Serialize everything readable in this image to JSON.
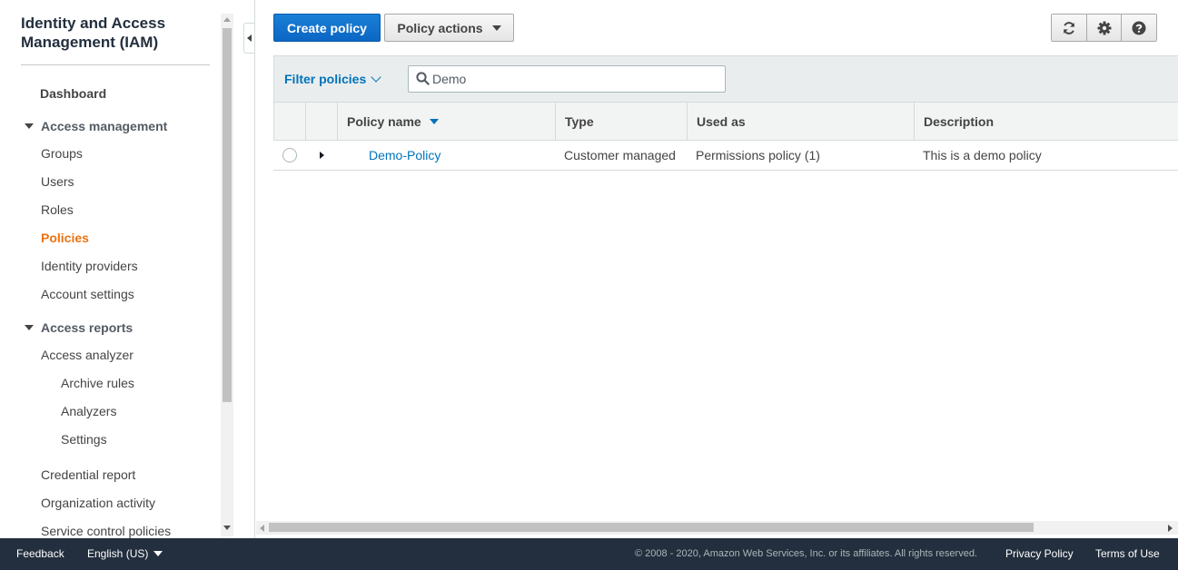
{
  "sidebar": {
    "title": "Identity and Access Management (IAM)",
    "dashboard": "Dashboard",
    "section_access_management": "Access management",
    "groups": "Groups",
    "users": "Users",
    "roles": "Roles",
    "policies": "Policies",
    "identity_providers": "Identity providers",
    "account_settings": "Account settings",
    "section_access_reports": "Access reports",
    "access_analyzer": "Access analyzer",
    "archive_rules": "Archive rules",
    "analyzers": "Analyzers",
    "settings": "Settings",
    "credential_report": "Credential report",
    "organization_activity": "Organization activity",
    "service_control_policies": "Service control policies",
    "active_item": "Policies"
  },
  "toolbar": {
    "create_label": "Create policy",
    "actions_label": "Policy actions",
    "icons": [
      "refresh-icon",
      "gear-icon",
      "help-icon"
    ]
  },
  "filter": {
    "label": "Filter policies",
    "search_value": "Demo"
  },
  "table": {
    "headers": {
      "policy_name": "Policy name",
      "type": "Type",
      "used_as": "Used as",
      "description": "Description"
    },
    "rows": [
      {
        "policy_name": "Demo-Policy",
        "type": "Customer managed",
        "used_as": "Permissions policy (1)",
        "description": "This is a demo policy"
      }
    ]
  },
  "footer": {
    "feedback": "Feedback",
    "language": "English (US)",
    "copyright": "© 2008 - 2020, Amazon Web Services, Inc. or its affiliates. All rights reserved.",
    "privacy": "Privacy Policy",
    "terms": "Terms of Use"
  },
  "colors": {
    "primary_button": "#0b66c4",
    "active_nav": "#ec7211",
    "link": "#0073bb",
    "footer_bg": "#232f3e"
  }
}
